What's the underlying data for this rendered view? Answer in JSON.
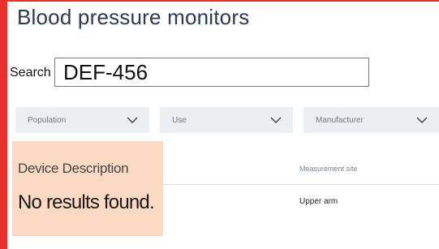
{
  "page": {
    "title": "Blood pressure monitors"
  },
  "search": {
    "label": "Search",
    "value": "DEF-456"
  },
  "filters": [
    {
      "label": "Population",
      "icon": "chevron-down-icon"
    },
    {
      "label": "Use",
      "icon": "chevron-down-icon"
    },
    {
      "label": "Manufacturer",
      "icon": "chevron-down-icon"
    }
  ],
  "table": {
    "columns": [
      "Device Description",
      "Measurement site"
    ],
    "empty_message": "No results found.",
    "rows": [
      {
        "measurement_site": "Upper arm"
      }
    ]
  },
  "colors": {
    "accent": "#e8312b",
    "title": "#2b3a55",
    "filter_bg": "#eceff2",
    "highlight": "#fcd9c3"
  }
}
